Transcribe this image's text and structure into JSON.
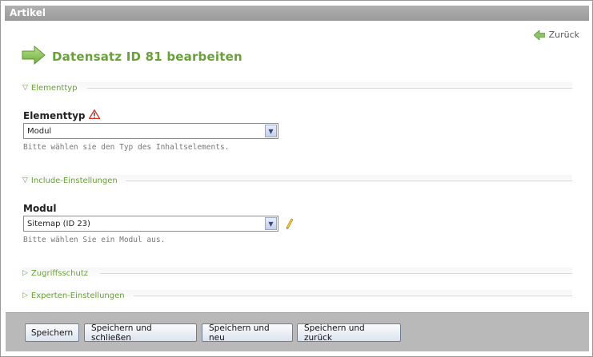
{
  "window": {
    "title": "Artikel"
  },
  "nav": {
    "back_label": "Zurück"
  },
  "page": {
    "heading": "Datensatz ID 81 bearbeiten"
  },
  "sections": {
    "elementtyp": {
      "legend": "Elementtyp",
      "expanded": true,
      "field_label": "Elementtyp",
      "warning_icon": "warning-icon",
      "select_value": "Modul",
      "help": "Bitte wählen sie den Typ des Inhaltselements."
    },
    "include": {
      "legend": "Include-Einstellungen",
      "expanded": true,
      "field_label": "Modul",
      "select_value": "Sitemap (ID 23)",
      "edit_icon": "pencil-icon",
      "help": "Bitte wählen Sie ein Modul aus."
    },
    "zugriffsschutz": {
      "legend": "Zugriffsschutz",
      "expanded": false
    },
    "experten": {
      "legend": "Experten-Einstellungen",
      "expanded": false
    }
  },
  "buttons": {
    "save": "Speichern",
    "save_close": "Speichern und schließen",
    "save_new": "Speichern und neu",
    "save_back": "Speichern und zurück"
  },
  "colors": {
    "accent_green": "#6aa03a",
    "titlebar": "#a6a6a6",
    "footer": "#b9b9b9"
  }
}
